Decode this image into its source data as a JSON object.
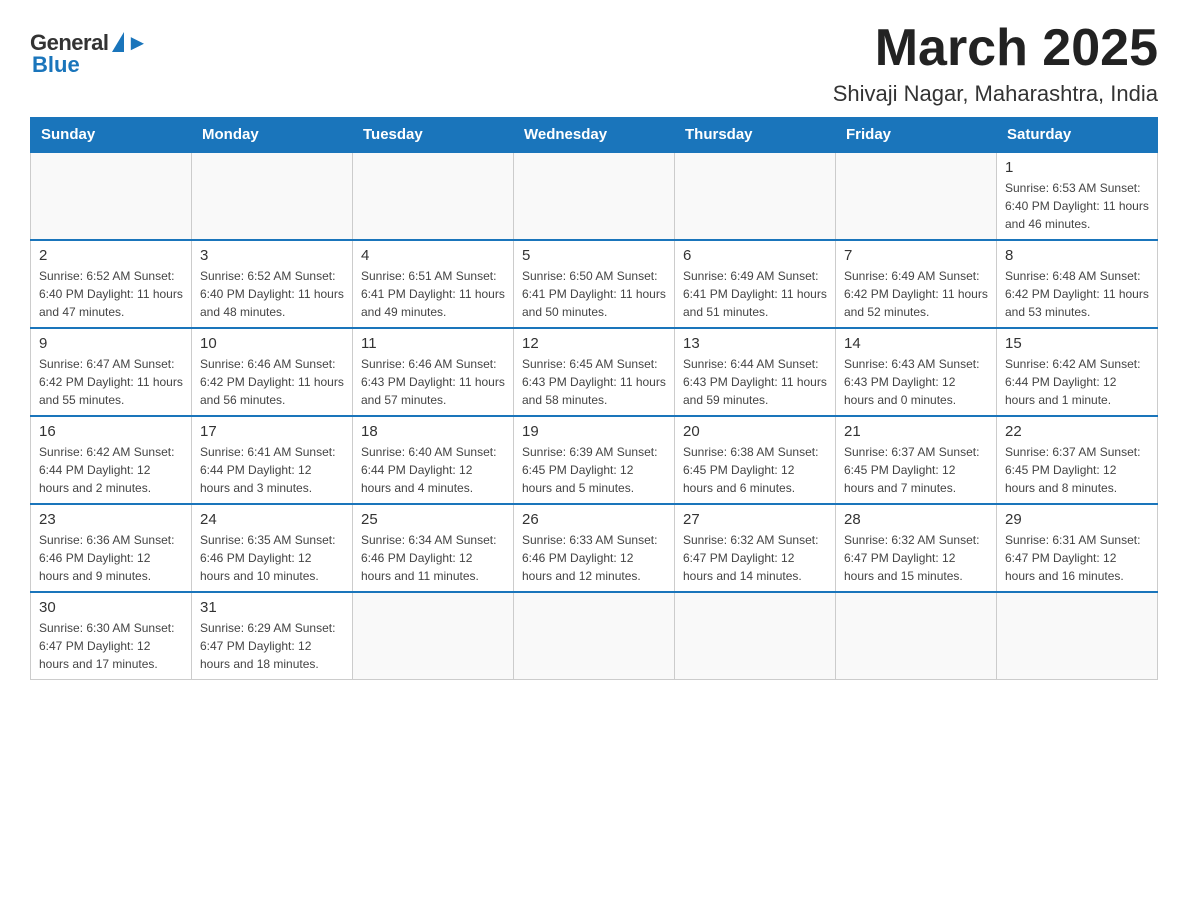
{
  "header": {
    "logo_general": "General",
    "logo_blue": "Blue",
    "main_title": "March 2025",
    "subtitle": "Shivaji Nagar, Maharashtra, India"
  },
  "weekdays": [
    "Sunday",
    "Monday",
    "Tuesday",
    "Wednesday",
    "Thursday",
    "Friday",
    "Saturday"
  ],
  "weeks": [
    [
      {
        "day": "",
        "info": ""
      },
      {
        "day": "",
        "info": ""
      },
      {
        "day": "",
        "info": ""
      },
      {
        "day": "",
        "info": ""
      },
      {
        "day": "",
        "info": ""
      },
      {
        "day": "",
        "info": ""
      },
      {
        "day": "1",
        "info": "Sunrise: 6:53 AM\nSunset: 6:40 PM\nDaylight: 11 hours\nand 46 minutes."
      }
    ],
    [
      {
        "day": "2",
        "info": "Sunrise: 6:52 AM\nSunset: 6:40 PM\nDaylight: 11 hours\nand 47 minutes."
      },
      {
        "day": "3",
        "info": "Sunrise: 6:52 AM\nSunset: 6:40 PM\nDaylight: 11 hours\nand 48 minutes."
      },
      {
        "day": "4",
        "info": "Sunrise: 6:51 AM\nSunset: 6:41 PM\nDaylight: 11 hours\nand 49 minutes."
      },
      {
        "day": "5",
        "info": "Sunrise: 6:50 AM\nSunset: 6:41 PM\nDaylight: 11 hours\nand 50 minutes."
      },
      {
        "day": "6",
        "info": "Sunrise: 6:49 AM\nSunset: 6:41 PM\nDaylight: 11 hours\nand 51 minutes."
      },
      {
        "day": "7",
        "info": "Sunrise: 6:49 AM\nSunset: 6:42 PM\nDaylight: 11 hours\nand 52 minutes."
      },
      {
        "day": "8",
        "info": "Sunrise: 6:48 AM\nSunset: 6:42 PM\nDaylight: 11 hours\nand 53 minutes."
      }
    ],
    [
      {
        "day": "9",
        "info": "Sunrise: 6:47 AM\nSunset: 6:42 PM\nDaylight: 11 hours\nand 55 minutes."
      },
      {
        "day": "10",
        "info": "Sunrise: 6:46 AM\nSunset: 6:42 PM\nDaylight: 11 hours\nand 56 minutes."
      },
      {
        "day": "11",
        "info": "Sunrise: 6:46 AM\nSunset: 6:43 PM\nDaylight: 11 hours\nand 57 minutes."
      },
      {
        "day": "12",
        "info": "Sunrise: 6:45 AM\nSunset: 6:43 PM\nDaylight: 11 hours\nand 58 minutes."
      },
      {
        "day": "13",
        "info": "Sunrise: 6:44 AM\nSunset: 6:43 PM\nDaylight: 11 hours\nand 59 minutes."
      },
      {
        "day": "14",
        "info": "Sunrise: 6:43 AM\nSunset: 6:43 PM\nDaylight: 12 hours\nand 0 minutes."
      },
      {
        "day": "15",
        "info": "Sunrise: 6:42 AM\nSunset: 6:44 PM\nDaylight: 12 hours\nand 1 minute."
      }
    ],
    [
      {
        "day": "16",
        "info": "Sunrise: 6:42 AM\nSunset: 6:44 PM\nDaylight: 12 hours\nand 2 minutes."
      },
      {
        "day": "17",
        "info": "Sunrise: 6:41 AM\nSunset: 6:44 PM\nDaylight: 12 hours\nand 3 minutes."
      },
      {
        "day": "18",
        "info": "Sunrise: 6:40 AM\nSunset: 6:44 PM\nDaylight: 12 hours\nand 4 minutes."
      },
      {
        "day": "19",
        "info": "Sunrise: 6:39 AM\nSunset: 6:45 PM\nDaylight: 12 hours\nand 5 minutes."
      },
      {
        "day": "20",
        "info": "Sunrise: 6:38 AM\nSunset: 6:45 PM\nDaylight: 12 hours\nand 6 minutes."
      },
      {
        "day": "21",
        "info": "Sunrise: 6:37 AM\nSunset: 6:45 PM\nDaylight: 12 hours\nand 7 minutes."
      },
      {
        "day": "22",
        "info": "Sunrise: 6:37 AM\nSunset: 6:45 PM\nDaylight: 12 hours\nand 8 minutes."
      }
    ],
    [
      {
        "day": "23",
        "info": "Sunrise: 6:36 AM\nSunset: 6:46 PM\nDaylight: 12 hours\nand 9 minutes."
      },
      {
        "day": "24",
        "info": "Sunrise: 6:35 AM\nSunset: 6:46 PM\nDaylight: 12 hours\nand 10 minutes."
      },
      {
        "day": "25",
        "info": "Sunrise: 6:34 AM\nSunset: 6:46 PM\nDaylight: 12 hours\nand 11 minutes."
      },
      {
        "day": "26",
        "info": "Sunrise: 6:33 AM\nSunset: 6:46 PM\nDaylight: 12 hours\nand 12 minutes."
      },
      {
        "day": "27",
        "info": "Sunrise: 6:32 AM\nSunset: 6:47 PM\nDaylight: 12 hours\nand 14 minutes."
      },
      {
        "day": "28",
        "info": "Sunrise: 6:32 AM\nSunset: 6:47 PM\nDaylight: 12 hours\nand 15 minutes."
      },
      {
        "day": "29",
        "info": "Sunrise: 6:31 AM\nSunset: 6:47 PM\nDaylight: 12 hours\nand 16 minutes."
      }
    ],
    [
      {
        "day": "30",
        "info": "Sunrise: 6:30 AM\nSunset: 6:47 PM\nDaylight: 12 hours\nand 17 minutes."
      },
      {
        "day": "31",
        "info": "Sunrise: 6:29 AM\nSunset: 6:47 PM\nDaylight: 12 hours\nand 18 minutes."
      },
      {
        "day": "",
        "info": ""
      },
      {
        "day": "",
        "info": ""
      },
      {
        "day": "",
        "info": ""
      },
      {
        "day": "",
        "info": ""
      },
      {
        "day": "",
        "info": ""
      }
    ]
  ]
}
